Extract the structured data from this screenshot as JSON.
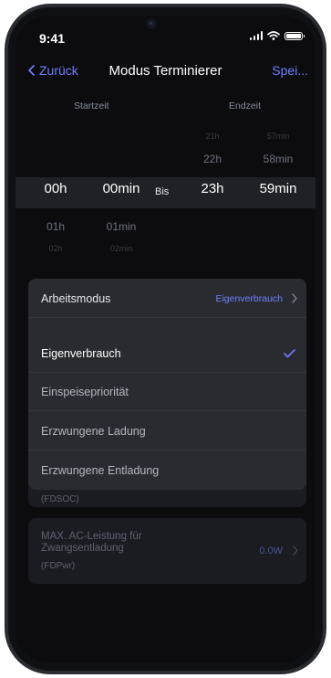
{
  "status_bar": {
    "time": "9:41"
  },
  "nav": {
    "back_label": "Zurück",
    "title": "Modus Terminierer",
    "save_label": "Spei..."
  },
  "columns": {
    "start": "Startzeit",
    "end": "Endzeit"
  },
  "picker": {
    "separator": "Bis",
    "start_hours": [
      "00h",
      "01h",
      "02h"
    ],
    "start_minutes": [
      "00min",
      "01min",
      "02min"
    ],
    "end_hours": [
      "21h",
      "22h",
      "23h"
    ],
    "end_minutes": [
      "57min",
      "58min",
      "59min"
    ]
  },
  "dropdown": {
    "header_label": "Arbeitsmodus",
    "header_value": "Eigenverbrauch",
    "options": [
      {
        "label": "Eigenverbrauch",
        "selected": true
      },
      {
        "label": "Einspeisepriorität",
        "selected": false
      },
      {
        "label": "Erzwungene Ladung",
        "selected": false
      },
      {
        "label": "Erzwungene Entladung",
        "selected": false
      }
    ]
  },
  "background_settings": {
    "fdsoc_code": "(FDSOC)",
    "fdpwr": {
      "label": "MAX. AC-Leistung für Zwangsentladung",
      "code": "(FDPwr)",
      "value": "0.0W"
    }
  },
  "colors": {
    "accent": "#6f80ff",
    "background": "#0c0c0f",
    "panel": "#2a2b31",
    "selection": "#202127"
  }
}
